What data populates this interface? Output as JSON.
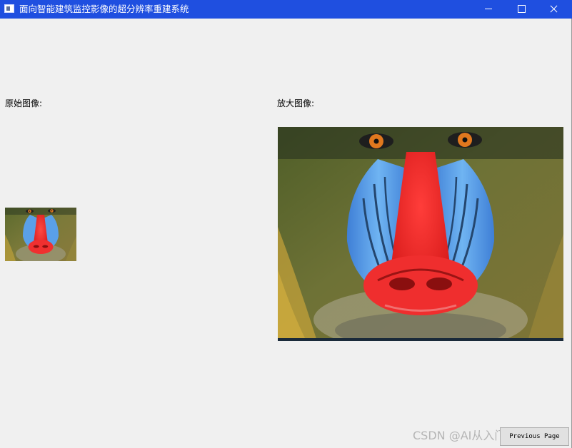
{
  "window": {
    "title": "面向智能建筑监控影像的超分辨率重建系统"
  },
  "labels": {
    "original": "原始图像:",
    "enlarged": "放大图像:"
  },
  "buttons": {
    "previous_page": "Previous Page"
  },
  "watermark": "CSDN @AI从入门到实践",
  "colors": {
    "titlebar": "#1f4fe0",
    "background": "#f0f0f0"
  }
}
